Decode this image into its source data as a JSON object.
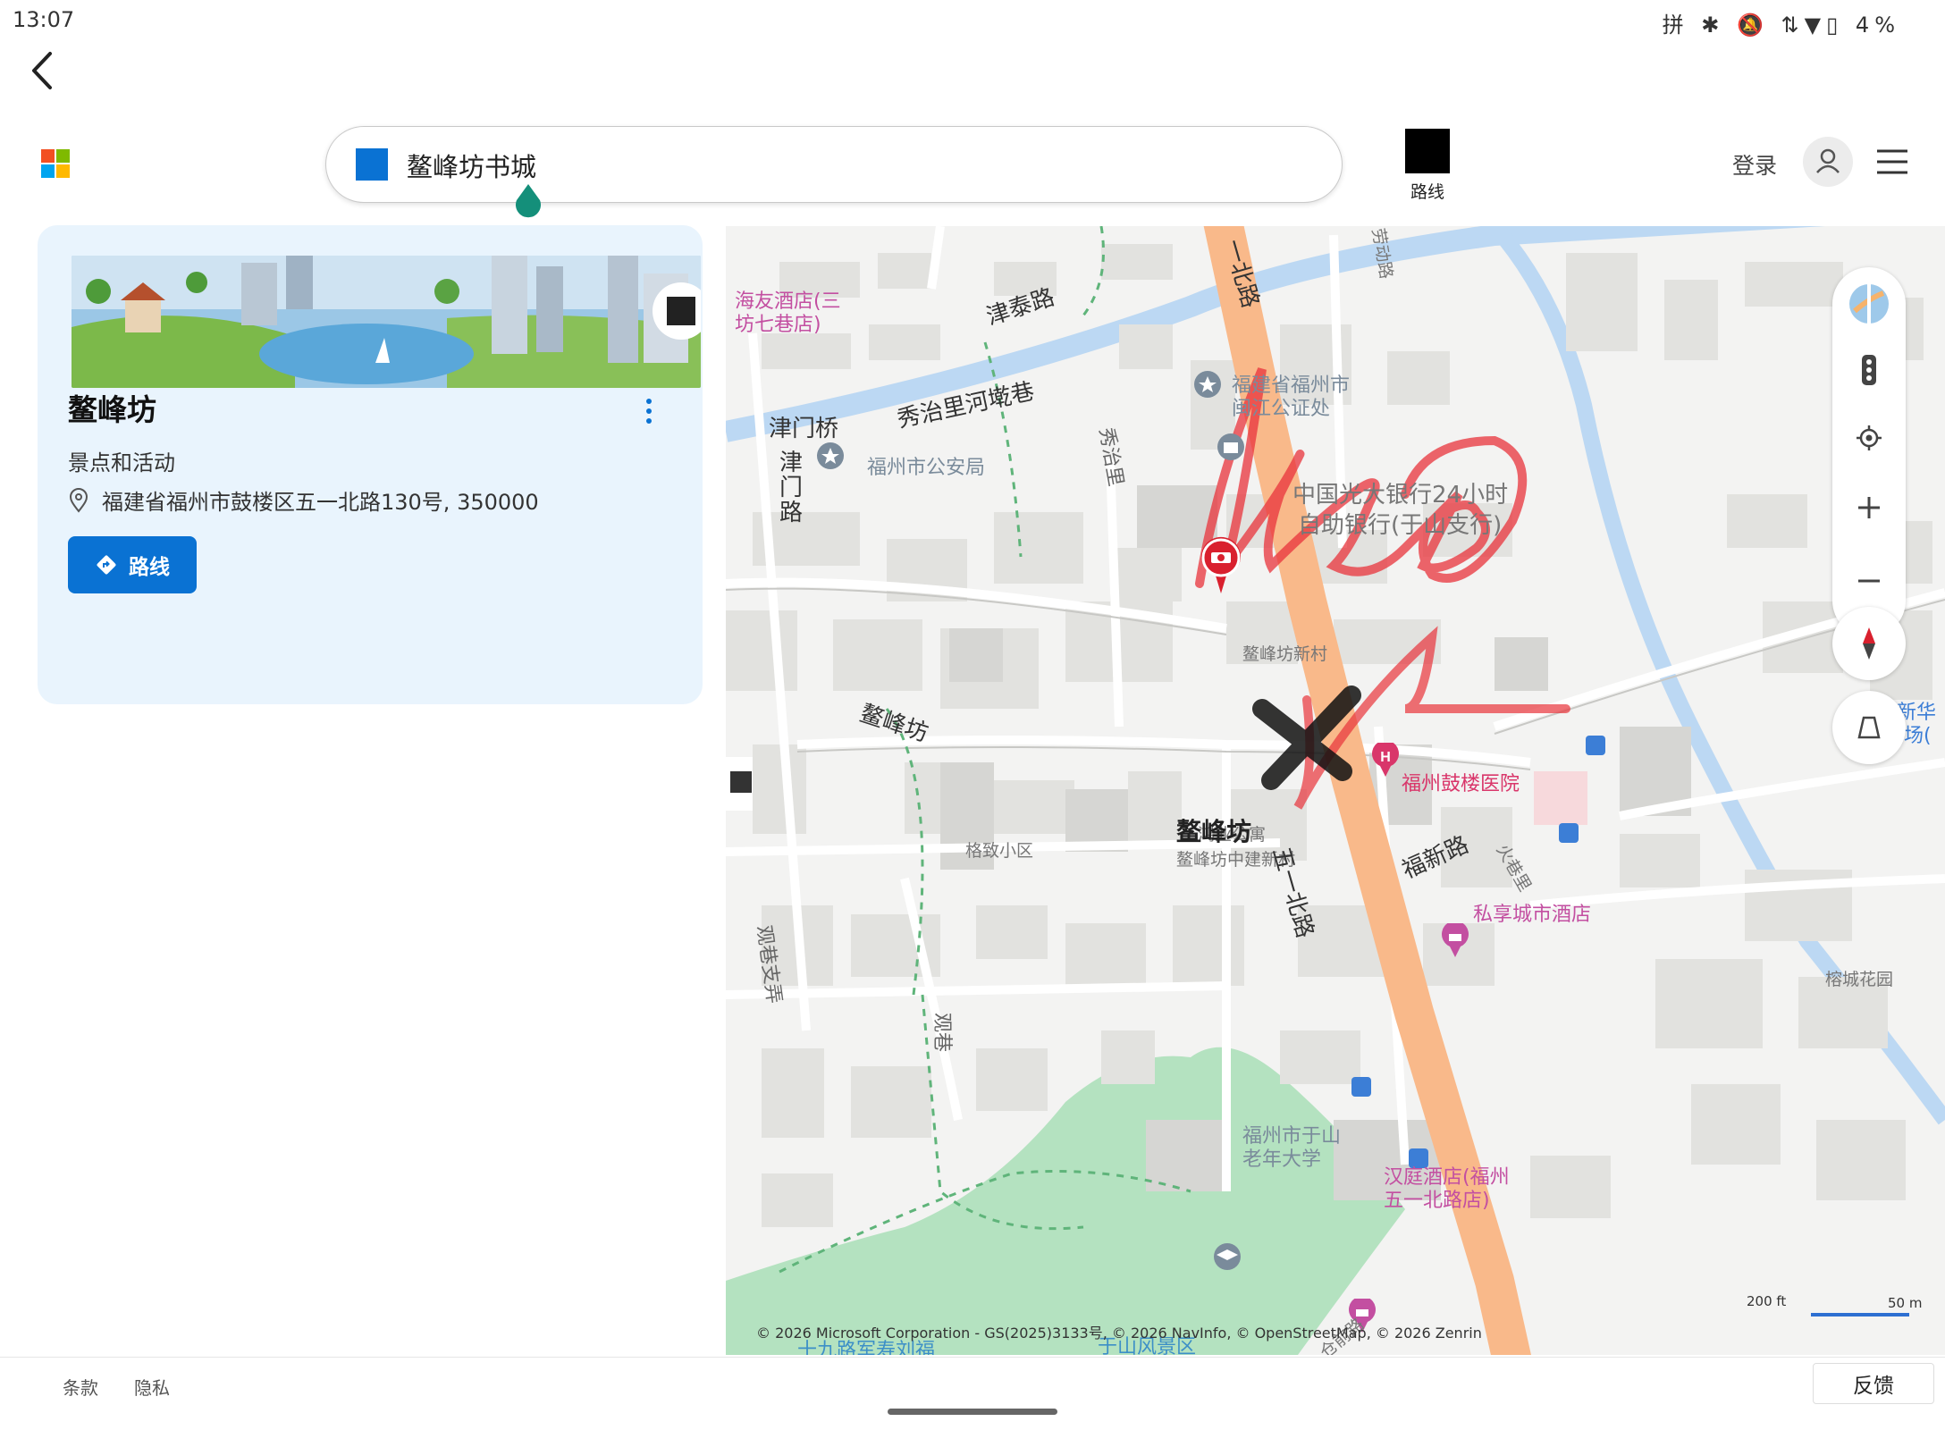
{
  "status_bar": {
    "time": "13:07",
    "icons": "拼 ✱ 🔕 ⇅▼▯ 4%"
  },
  "header": {
    "search_value": "鳌峰坊书城",
    "route_label": "路线",
    "login_label": "登录"
  },
  "place": {
    "title": "鳌峰坊",
    "category": "景点和活动",
    "address": "福建省福州市鼓楼区五一北路130号, 350000",
    "route_button": "路线"
  },
  "map": {
    "labels": {
      "haiyou": "海友酒店(三",
      "haiyou2": "坊七巷店)",
      "jintai": "津泰路",
      "yinmen": "津门桥",
      "xiuyeli": "秀治里河墘巷",
      "jinmenlu1": "津",
      "jinmenlu2": "门",
      "jinmenlu3": "路",
      "gongan": "福州市公安局",
      "xiuyeli2": "秀治里",
      "gongzheng1": "福建省福州市",
      "gongzheng2": "闽江公证处",
      "everbright1": "中国光大银行24小时",
      "everbright2": "自助银行(于山支行)",
      "aofengfang_road": "鳌峰坊",
      "aofeng_newvillage": "鳌峰坊新村",
      "gezhi": "格致小区",
      "hongye": "鸿业公寓",
      "pin_name": "鳌峰坊",
      "pin_sub": "鳌峰坊中建新村",
      "hospital": "福州鼓楼医院",
      "fuxin": "福新路",
      "wuyi_bei": "五一北路",
      "yi_bei_top": "一北路",
      "laodong": "劳动路",
      "xinhua1": "新华",
      "xinhua2": "广场(",
      "hotel_private": "私享城市酒店",
      "rongcheng": "榕城花园",
      "guanxiang_zhi": "观巷支弄",
      "guanxiang": "观巷",
      "yushan_univ1": "福州市于山",
      "yushan_univ2": "老年大学",
      "hanting1": "汉庭酒店(福州",
      "hanting2": "五一北路店)",
      "huojie": "火巷里",
      "shijiulu": "十九路军寿刘福",
      "yushan_scenic": "于山风景区",
      "cangxia": "仓前路"
    },
    "attribution": "© 2026 Microsoft Corporation - GS(2025)3133号, © 2026 NavInfo, © OpenStreetMap, © 2026 Zenrin",
    "scale_ft": "200 ft",
    "scale_m": "50 m",
    "annotation_text": "here"
  },
  "footer": {
    "terms": "条款",
    "privacy": "隐私",
    "feedback": "反馈"
  },
  "colors": {
    "accent": "#0a72d3",
    "main_road": "#f9b98a",
    "river": "#bcd8f3",
    "park": "#b4e2c0",
    "annotation_red": "#e8333b",
    "pin_red": "#d9202e"
  }
}
